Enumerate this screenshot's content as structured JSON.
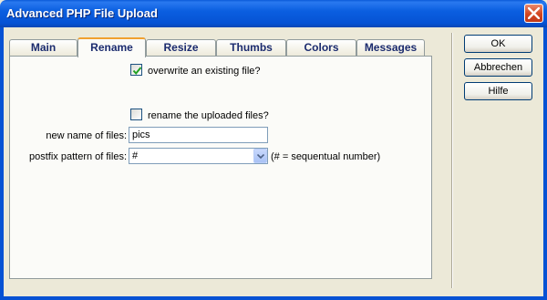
{
  "window": {
    "title": "Advanced PHP File Upload"
  },
  "tabs": [
    {
      "label": "Main"
    },
    {
      "label": "Rename"
    },
    {
      "label": "Resize"
    },
    {
      "label": "Thumbs"
    },
    {
      "label": "Colors"
    },
    {
      "label": "Messages"
    }
  ],
  "active_tab": "Rename",
  "rename": {
    "overwrite_label": "overwrite an existing file?",
    "overwrite_checked": true,
    "rename_label": "rename the uploaded files?",
    "rename_checked": false,
    "new_name_label": "new name of files:",
    "new_name_value": "pics",
    "postfix_label": "postfix pattern of files:",
    "postfix_value": "#",
    "postfix_hint": "(# = sequentual number)"
  },
  "buttons": {
    "ok": "OK",
    "cancel": "Abbrechen",
    "help": "Hilfe"
  },
  "colors": {
    "titlebar": "#0652d4",
    "active_tab_accent": "#f0a030",
    "check": "#21a121"
  }
}
